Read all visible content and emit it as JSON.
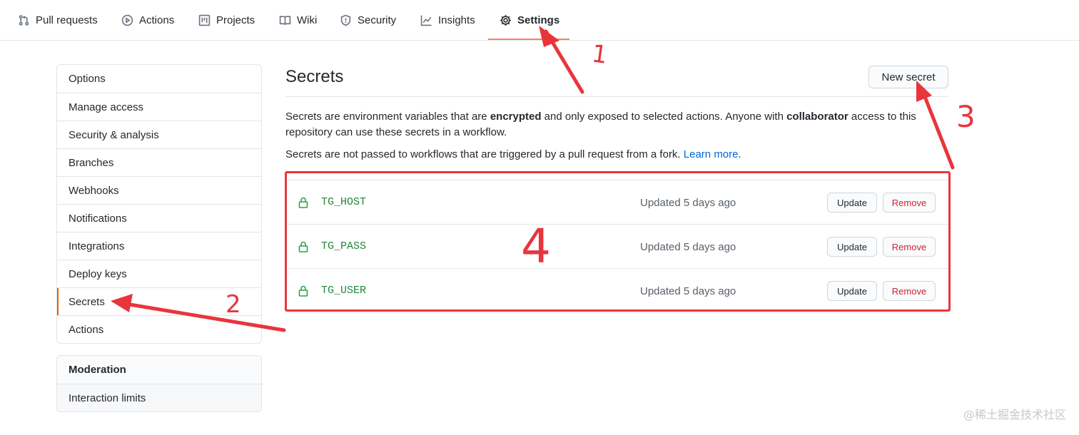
{
  "topnav": {
    "tabs": [
      {
        "label": "Pull requests",
        "icon": "pull-request-icon"
      },
      {
        "label": "Actions",
        "icon": "play-icon"
      },
      {
        "label": "Projects",
        "icon": "project-icon"
      },
      {
        "label": "Wiki",
        "icon": "book-icon"
      },
      {
        "label": "Security",
        "icon": "shield-icon"
      },
      {
        "label": "Insights",
        "icon": "graph-icon"
      },
      {
        "label": "Settings",
        "icon": "gear-icon",
        "selected": true
      }
    ]
  },
  "sidebar": {
    "items": [
      {
        "label": "Options"
      },
      {
        "label": "Manage access"
      },
      {
        "label": "Security & analysis"
      },
      {
        "label": "Branches"
      },
      {
        "label": "Webhooks"
      },
      {
        "label": "Notifications"
      },
      {
        "label": "Integrations"
      },
      {
        "label": "Deploy keys"
      },
      {
        "label": "Secrets",
        "selected": true
      },
      {
        "label": "Actions"
      }
    ],
    "moderation": {
      "heading": "Moderation",
      "items": [
        {
          "label": "Interaction limits"
        }
      ]
    }
  },
  "main": {
    "title": "Secrets",
    "new_secret_label": "New secret",
    "description": {
      "part1": "Secrets are environment variables that are ",
      "bold1": "encrypted",
      "part2": " and only exposed to selected actions. Anyone with ",
      "bold2": "collaborator",
      "part3": " access to this repository can use these secrets in a workflow."
    },
    "fork_note": "Secrets are not passed to workflows that are triggered by a pull request from a fork.",
    "learn_more": "Learn more",
    "period": ".",
    "secrets": [
      {
        "name": "TG_HOST",
        "updated": "Updated 5 days ago",
        "update_label": "Update",
        "remove_label": "Remove"
      },
      {
        "name": "TG_PASS",
        "updated": "Updated 5 days ago",
        "update_label": "Update",
        "remove_label": "Remove"
      },
      {
        "name": "TG_USER",
        "updated": "Updated 5 days ago",
        "update_label": "Update",
        "remove_label": "Remove"
      }
    ]
  },
  "annotations": {
    "color": "#e8353c",
    "numbers": [
      "1",
      "2",
      "3",
      "4"
    ]
  },
  "watermark": "@稀土掘金技术社区",
  "colors": {
    "accent_underline": "#f9826c",
    "secret_name": "#22863a",
    "remove_text": "#cb2431",
    "link": "#0366d6"
  }
}
